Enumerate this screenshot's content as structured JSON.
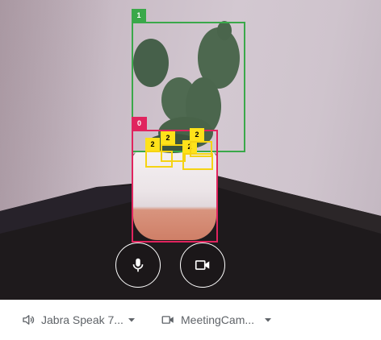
{
  "preview": {
    "detections": [
      {
        "label": "1",
        "color": "#3aa84a"
      },
      {
        "label": "0",
        "color": "#e0245e"
      },
      {
        "label": "2",
        "color": "#f5d313"
      },
      {
        "label": "2",
        "color": "#f5d313"
      },
      {
        "label": "2",
        "color": "#f5d313"
      },
      {
        "label": "2",
        "color": "#f5d313"
      }
    ],
    "controls": {
      "mic_icon": "microphone-icon",
      "camera_icon": "video-camera-icon"
    }
  },
  "devices": {
    "audio": {
      "icon": "speaker-icon",
      "name": "Jabra Speak 7..."
    },
    "video": {
      "icon": "video-camera-icon",
      "name": "MeetingCam..."
    }
  }
}
